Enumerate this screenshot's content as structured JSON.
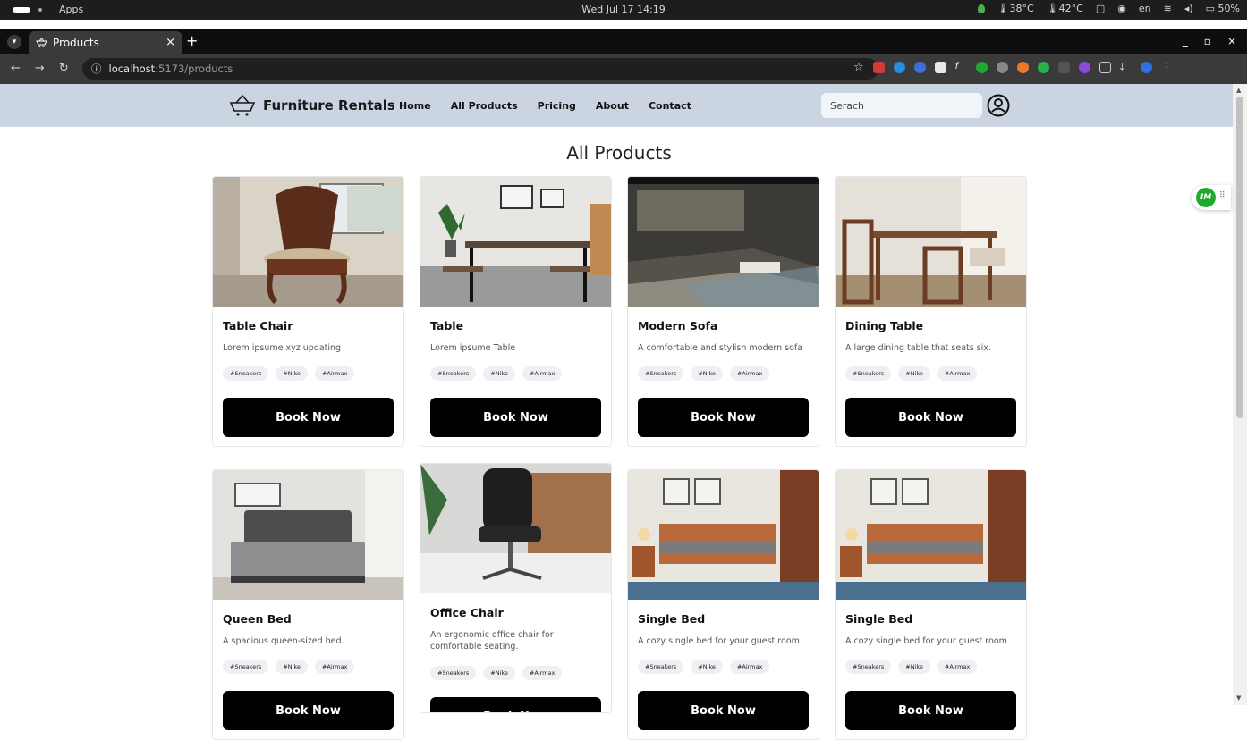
{
  "os": {
    "apps_label": "Apps",
    "clock": "Wed Jul 17 14:19",
    "temp1": "38°C",
    "temp2": "42°C",
    "lang": "en",
    "battery": "50%"
  },
  "browser": {
    "tab_title": "Products",
    "url_host": "localhost",
    "url_rest": ":5173/products",
    "window_controls": [
      "_",
      "▫",
      "×"
    ]
  },
  "site": {
    "brand": "Furniture Rentals",
    "nav": [
      "Home",
      "All Products",
      "Pricing",
      "About",
      "Contact"
    ],
    "search_placeholder": "Serach"
  },
  "widget": {
    "badge": "IM"
  },
  "page": {
    "title": "All Products"
  },
  "products": [
    {
      "title": "Table Chair",
      "desc": "Lorem ipsume xyz updating",
      "tags": [
        "#Sneakers",
        "#Nike",
        "#Airmax"
      ],
      "button": "Book Now"
    },
    {
      "title": "Table",
      "desc": "Lorem ipsume Table",
      "tags": [
        "#Sneakers",
        "#Nike",
        "#Airmax"
      ],
      "button": "Book Now"
    },
    {
      "title": "Modern Sofa",
      "desc": "A comfortable and stylish modern sofa",
      "tags": [
        "#Sneakers",
        "#Nike",
        "#Airmax"
      ],
      "button": "Book Now"
    },
    {
      "title": "Dining Table",
      "desc": "A large dining table that seats six.",
      "tags": [
        "#Sneakers",
        "#Nike",
        "#Airmax"
      ],
      "button": "Book Now"
    },
    {
      "title": "Queen Bed",
      "desc": "A spacious queen-sized bed.",
      "tags": [
        "#Sneakers",
        "#Nike",
        "#Airmax"
      ],
      "button": "Book Now"
    },
    {
      "title": "Office Chair",
      "desc": "An ergonomic office chair for comfortable seating.",
      "tags": [
        "#Sneakers",
        "#Nike",
        "#Airmax"
      ],
      "button": "Book Now"
    },
    {
      "title": "Single Bed",
      "desc": "A cozy single bed for your guest room",
      "tags": [
        "#Sneakers",
        "#Nike",
        "#Airmax"
      ],
      "button": "Book Now"
    },
    {
      "title": "Single Bed",
      "desc": "A cozy single bed for your guest room",
      "tags": [
        "#Sneakers",
        "#Nike",
        "#Airmax"
      ],
      "button": "Book Now"
    }
  ]
}
